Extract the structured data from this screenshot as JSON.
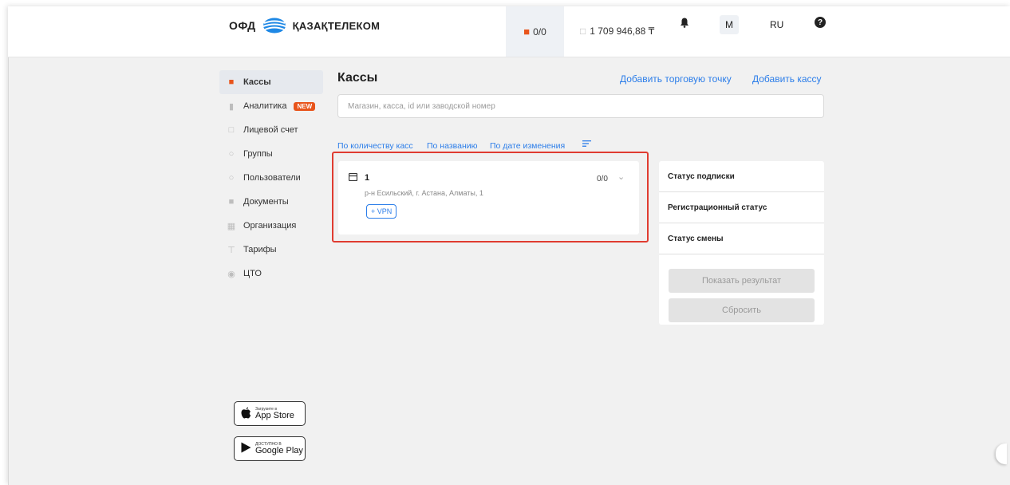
{
  "header": {
    "logo_left": "ОФД",
    "logo_right": "ҚАЗАҚТЕЛЕКОМ",
    "counter": "0/0",
    "balance": "1 709 946,88 ₸",
    "avatar": "М",
    "lang": "RU",
    "help": "?",
    "icons": {
      "counter": "cash-register-icon",
      "balance": "wallet-icon",
      "bell": "bell-icon",
      "help": "help-icon"
    },
    "accent": "#e8541b"
  },
  "sidebar": {
    "items": [
      {
        "label": "Кассы",
        "icon": "cash-register-icon"
      },
      {
        "label": "Аналитика",
        "icon": "chart-icon",
        "badge": "NEW"
      },
      {
        "label": "Лицевой счет",
        "icon": "account-icon"
      },
      {
        "label": "Группы",
        "icon": "groups-icon"
      },
      {
        "label": "Пользователи",
        "icon": "user-icon"
      },
      {
        "label": "Документы",
        "icon": "document-icon"
      },
      {
        "label": "Организация",
        "icon": "building-icon"
      },
      {
        "label": "Тарифы",
        "icon": "tariff-icon"
      },
      {
        "label": "ЦТО",
        "icon": "service-icon"
      }
    ],
    "appstore_small": "Загрузите в",
    "appstore_big": "App Store",
    "googleplay_small": "ДОСТУПНО В",
    "googleplay_big": "Google Play"
  },
  "main": {
    "title": "Кассы",
    "add_point": "Добавить торговую точку",
    "add_kassa": "Добавить кассу",
    "search_placeholder": "Магазин, касса, id или заводской номер",
    "sort": [
      "По количеству касс",
      "По названию",
      "По дате изменения"
    ],
    "link_color": "#2b7de9"
  },
  "card": {
    "name": "1",
    "count": "0/0",
    "address": "р-н Есильский, г. Астана, Алматы, 1",
    "vpn": "+ VPN"
  },
  "filter": {
    "rows": [
      "Статус подписки",
      "Регистрационный статус",
      "Статус смены"
    ],
    "show": "Показать результат",
    "reset": "Сбросить"
  }
}
